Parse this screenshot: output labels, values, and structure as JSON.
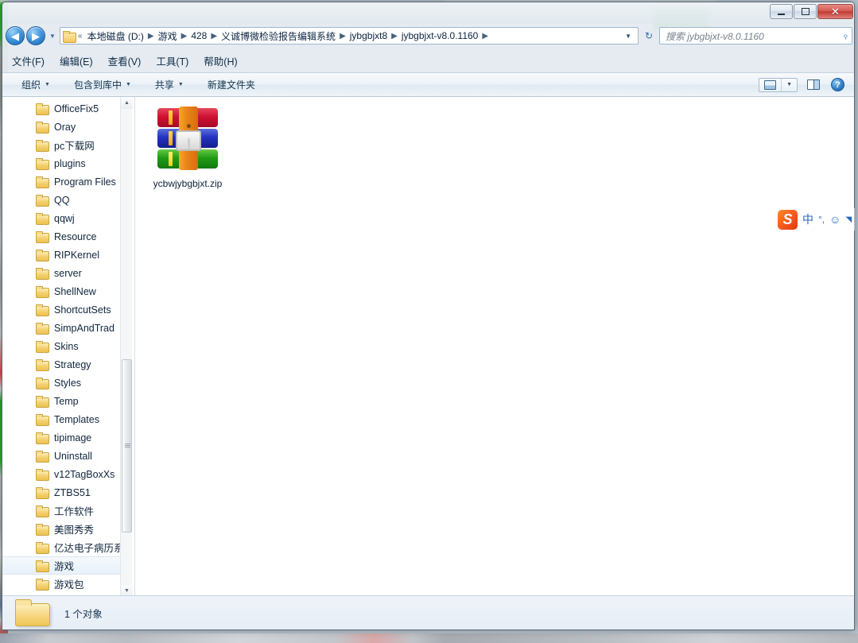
{
  "window": {
    "controls": {
      "minimize_label": "最小化",
      "maximize_label": "最大化",
      "close_label": "✕"
    }
  },
  "address_bar": {
    "back_glyph": "◀",
    "forward_glyph": "▶",
    "dropdown_glyph": "▼",
    "leading_chevrons": "«",
    "breadcrumb": [
      "本地磁盘 (D:)",
      "游戏",
      "428",
      "义诚博微检验报告编辑系统",
      "jybgbjxt8",
      "jybgbjxt-v8.0.1160"
    ],
    "separator": "▶",
    "caret_glyph": "▼",
    "refresh_glyph": "↻"
  },
  "search": {
    "placeholder": "搜索 jybgbjxt-v8.0.1160",
    "icon_glyph": "⌕"
  },
  "menu_bar": [
    {
      "label": "文件(F)"
    },
    {
      "label": "编辑(E)"
    },
    {
      "label": "查看(V)"
    },
    {
      "label": "工具(T)"
    },
    {
      "label": "帮助(H)"
    }
  ],
  "command_bar": {
    "items": [
      {
        "label": "组织",
        "has_caret": true
      },
      {
        "label": "包含到库中",
        "has_caret": true
      },
      {
        "label": "共享",
        "has_caret": true
      },
      {
        "label": "新建文件夹",
        "has_caret": false
      }
    ],
    "caret_glyph": "▼",
    "help_glyph": "?"
  },
  "nav_pane": {
    "items": [
      {
        "label": "OfficeFix5",
        "selected": false
      },
      {
        "label": "Oray",
        "selected": false
      },
      {
        "label": "pc下载网",
        "selected": false
      },
      {
        "label": "plugins",
        "selected": false
      },
      {
        "label": "Program Files",
        "selected": false
      },
      {
        "label": "QQ",
        "selected": false
      },
      {
        "label": "qqwj",
        "selected": false
      },
      {
        "label": "Resource",
        "selected": false
      },
      {
        "label": "RIPKernel",
        "selected": false
      },
      {
        "label": "server",
        "selected": false
      },
      {
        "label": "ShellNew",
        "selected": false
      },
      {
        "label": "ShortcutSets",
        "selected": false
      },
      {
        "label": "SimpAndTrad",
        "selected": false
      },
      {
        "label": "Skins",
        "selected": false
      },
      {
        "label": "Strategy",
        "selected": false
      },
      {
        "label": "Styles",
        "selected": false
      },
      {
        "label": "Temp",
        "selected": false
      },
      {
        "label": "Templates",
        "selected": false
      },
      {
        "label": "tipimage",
        "selected": false
      },
      {
        "label": "Uninstall",
        "selected": false
      },
      {
        "label": "v12TagBoxXs",
        "selected": false
      },
      {
        "label": "ZTBS51",
        "selected": false
      },
      {
        "label": "工作软件",
        "selected": false
      },
      {
        "label": "美图秀秀",
        "selected": false
      },
      {
        "label": "亿达电子病历系",
        "selected": false
      },
      {
        "label": "游戏",
        "selected": true
      },
      {
        "label": "游戏包",
        "selected": false
      }
    ],
    "scroll_up_glyph": "▲",
    "scroll_down_glyph": "▼"
  },
  "content": {
    "files": [
      {
        "name": "ycbwjybgbjxt.zip",
        "icon": "winrar-zip-icon"
      }
    ]
  },
  "status_bar": {
    "text": "1 个对象"
  },
  "ime": {
    "logo_text": "S",
    "mode_label": "中",
    "punct_label": "°,",
    "smiley_label": "☺",
    "more_glyph": "◥"
  },
  "colors": {
    "accent_blue": "#2a6fb5",
    "close_red": "#bf3c34",
    "folder_yellow": "#f3ce6c",
    "sogou_orange": "#f4511e",
    "selection_blue": "#e8f1fa"
  }
}
